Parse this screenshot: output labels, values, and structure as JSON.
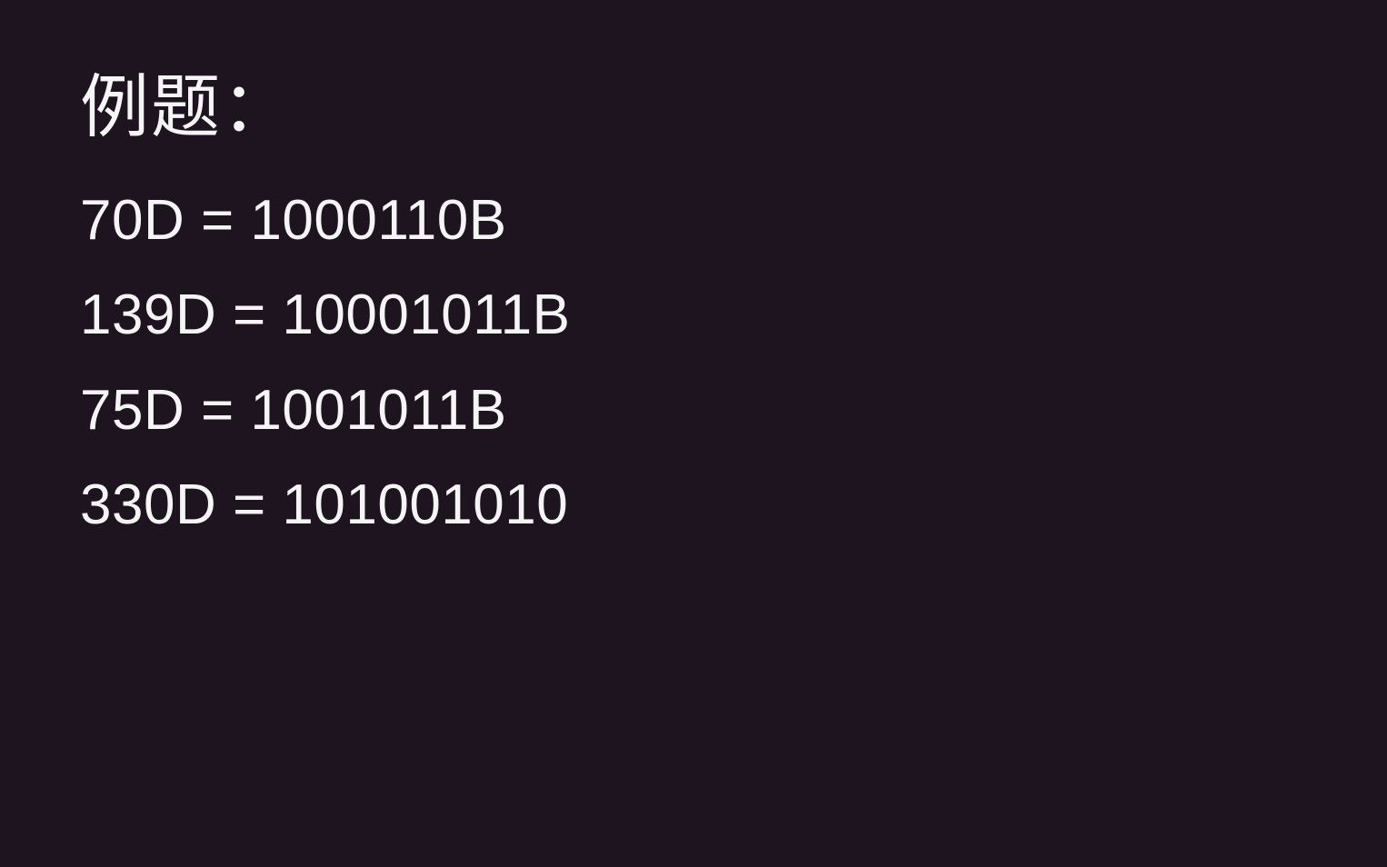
{
  "title": "例题：",
  "examples": [
    {
      "decimal": "70D",
      "equals": "=",
      "binary": "1000110B"
    },
    {
      "decimal": "139D",
      "equals": "=",
      "binary": "10001011B"
    },
    {
      "decimal": "75D",
      "equals": "=",
      "binary": "1001011B"
    },
    {
      "decimal": "330D",
      "equals": "=",
      "binary": "101001010"
    }
  ]
}
